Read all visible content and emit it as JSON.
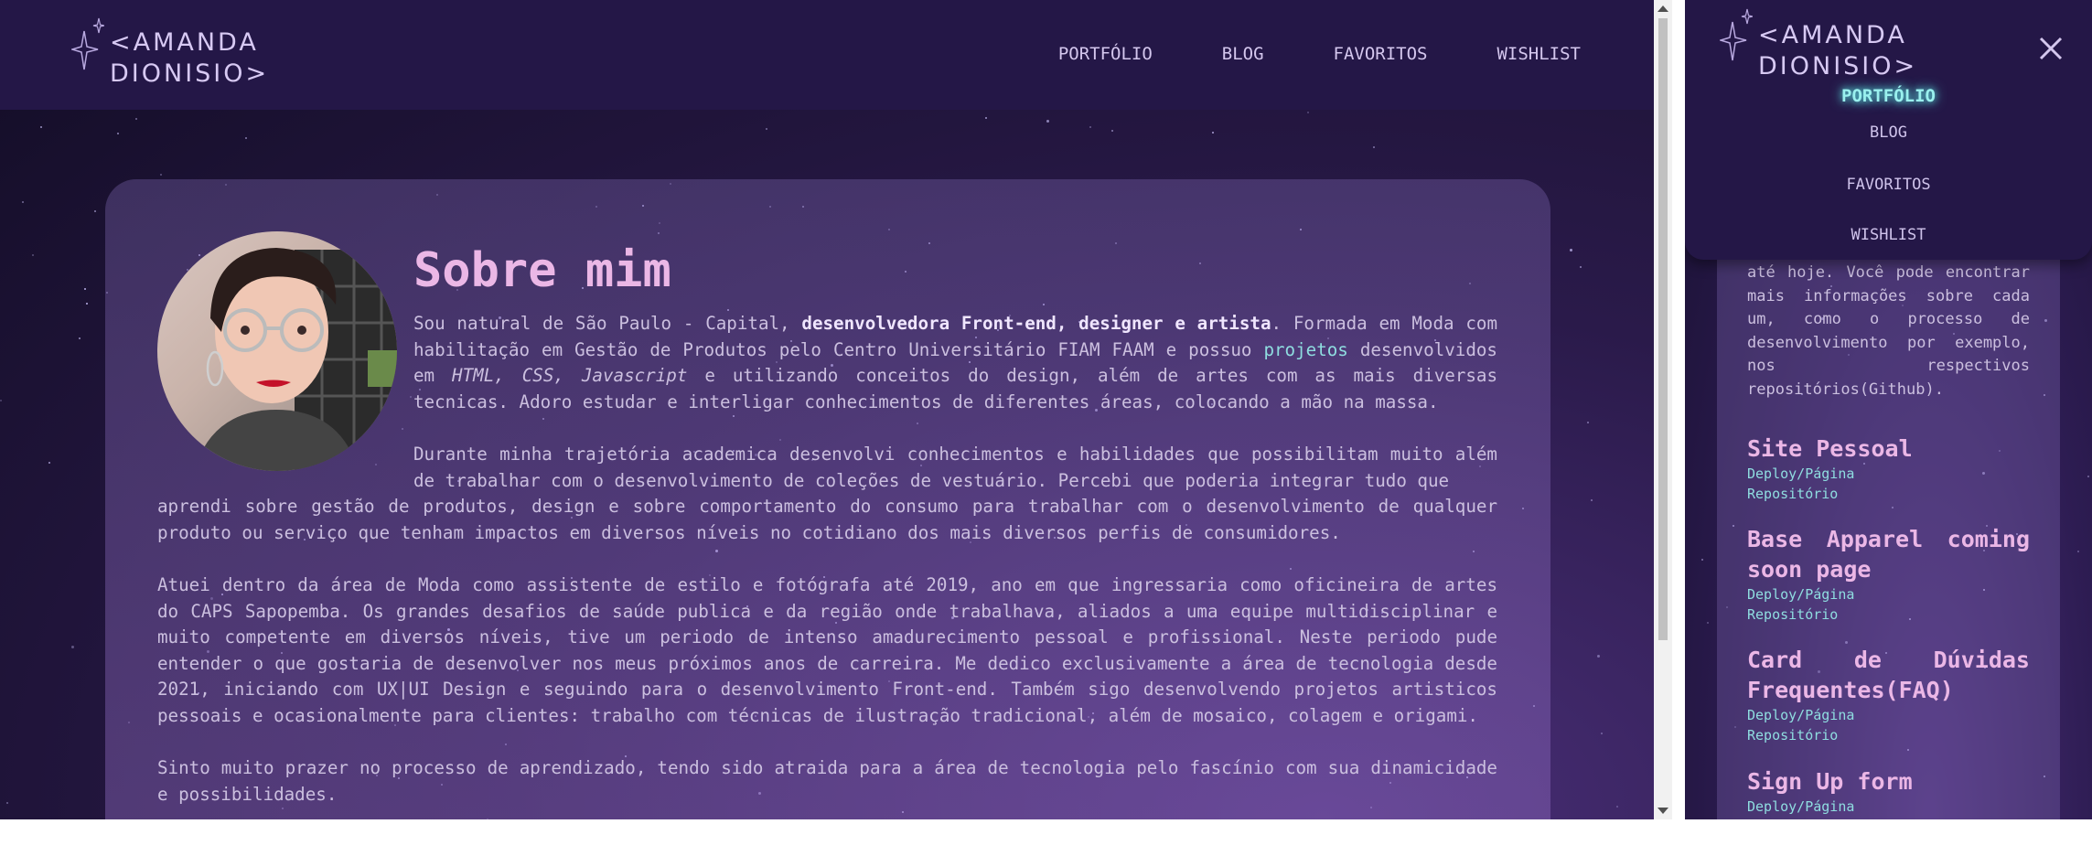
{
  "left": {
    "logo": {
      "line1": "<AMANDA",
      "line2": "DIONISIO>"
    },
    "nav": [
      "PORTFÓLIO",
      "BLOG",
      "FAVORITOS",
      "WISHLIST"
    ],
    "about": {
      "title": "Sobre mim",
      "p1": {
        "a": "Sou natural de São Paulo - Capital, ",
        "bold": "desenvolvedora Front-end, designer e artista",
        "b": ". Formada em Moda com habilitação em Gestão de Produtos pelo Centro Universitário FIAM FAAM e possuo ",
        "link": "projetos",
        "c": " desenvolvidos em ",
        "em": "HTML, CSS, Javascript",
        "d": " e utilizando conceitos do design, além de artes com as mais diversas tecnicas. Adoro estudar e interligar conhecimentos de diferentes áreas, colocando a mão na massa."
      },
      "p2a": "Durante minha trajetória academica desenvolvi conhecimentos e habilidades que possibilitam muito além de trabalhar com o desenvolvimento de coleções de vestuário. Percebi que poderia integrar tudo que",
      "p2b": "aprendi sobre gestão de produtos, design e sobre comportamento do consumo para trabalhar com o desenvolvimento de qualquer produto ou serviço que tenham impactos em diversos níveis no cotidiano dos mais diversos perfis de consumidores.",
      "p3": "Atuei dentro da área de Moda como assistente de estilo e fotógrafa até 2019, ano em que ingressaria como oficineira de artes do CAPS Sapopemba. Os grandes desafios de saúde publica e da região onde trabalhava, aliados a uma equipe multidisciplinar e muito competente em diversos níveis, tive um periodo de intenso amadurecimento pessoal e profissional. Neste periodo pude entender o que gostaria de desenvolver nos meus próximos anos de carreira. Me dedico exclusivamente a área de tecnologia desde 2021, iniciando com UX|UI Design e seguindo para o desenvolvimento Front-end. Também sigo desenvolvendo projetos artisticos pessoais e ocasionalmente para clientes: trabalho com técnicas de ilustração tradicional, além de mosaico, colagem e origami.",
      "p4": "Sinto muito prazer no processo de aprendizado, tendo sido atraida para a área de tecnologia pelo fascínio com sua dinamicidade e possibilidades."
    }
  },
  "right": {
    "logo": {
      "line1": "<AMANDA",
      "line2": "DIONISIO>"
    },
    "menu": [
      {
        "label": "PORTFÓLIO",
        "active": true
      },
      {
        "label": "BLOG"
      },
      {
        "label": "FAVORITOS"
      },
      {
        "label": "WISHLIST"
      }
    ],
    "intro": "até hoje. Você pode encontrar mais informações sobre cada um, como o processo de desenvolvimento por exemplo, nos respectivos repositórios(Github).",
    "projects": [
      {
        "title": "Site Pessoal",
        "links": [
          "Deploy/Página",
          "Repositório"
        ]
      },
      {
        "title": "Base Apparel coming soon page",
        "links": [
          "Deploy/Página",
          "Repositório"
        ]
      },
      {
        "title": "Card de Dúvidas Frequentes(FAQ)",
        "links": [
          "Deploy/Página",
          "Repositório"
        ]
      },
      {
        "title": "Sign Up form",
        "links": [
          "Deploy/Página"
        ]
      }
    ]
  },
  "icons": [
    "sparkle-icon",
    "close-icon"
  ],
  "colors": {
    "header": "#241747",
    "accent_title": "#ebb7e6",
    "link": "#8fdde0",
    "active_nav": "#9af0ee"
  }
}
